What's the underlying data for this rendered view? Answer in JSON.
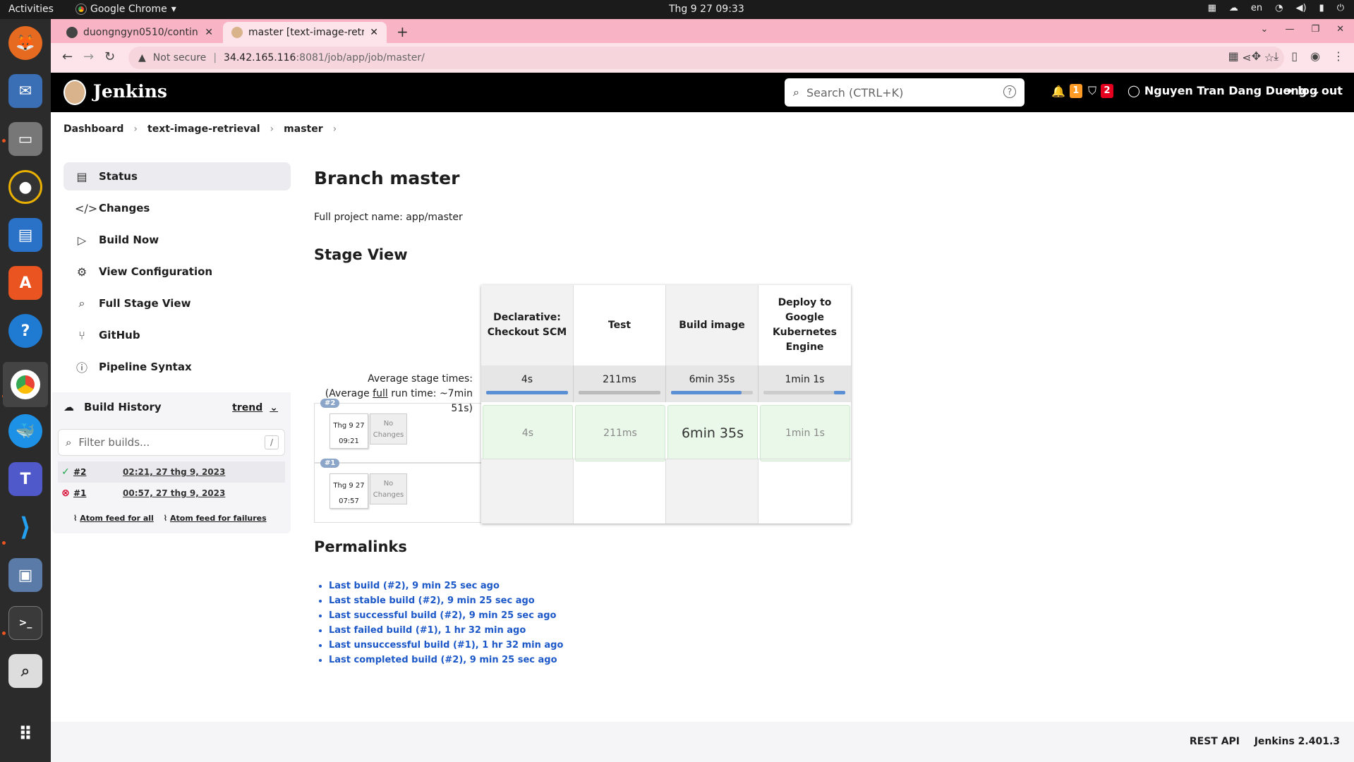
{
  "os": {
    "activities": "Activities",
    "app_name": "Google Chrome",
    "clock": "Thg 9 27  09:33",
    "lang": "en"
  },
  "browser": {
    "tabs": [
      {
        "title": "duongngyn0510/continu"
      },
      {
        "title": "master [text-image-retrie"
      }
    ],
    "not_secure": "Not secure",
    "url_host": "34.42.165.116",
    "url_path": ":8081/job/app/job/master/"
  },
  "jenkins": {
    "title": "Jenkins",
    "search_placeholder": "Search (CTRL+K)",
    "notifications_count": "1",
    "security_count": "2",
    "user": "Nguyen Tran Dang Duong",
    "logout": "log out"
  },
  "breadcrumb": [
    "Dashboard",
    "text-image-retrieval",
    "master"
  ],
  "side": {
    "items": [
      {
        "label": "Status",
        "icon": "status-icon"
      },
      {
        "label": "Changes",
        "icon": "code-icon"
      },
      {
        "label": "Build Now",
        "icon": "play-icon"
      },
      {
        "label": "View Configuration",
        "icon": "gear-icon"
      },
      {
        "label": "Full Stage View",
        "icon": "search-icon"
      },
      {
        "label": "GitHub",
        "icon": "branch-icon"
      },
      {
        "label": "Pipeline Syntax",
        "icon": "help-icon"
      }
    ]
  },
  "build_history": {
    "title": "Build History",
    "trend": "trend",
    "filter_placeholder": "Filter builds...",
    "filter_shortcut": "/",
    "builds": [
      {
        "num": "#2",
        "date": "02:21, 27 thg 9, 2023",
        "status": "success"
      },
      {
        "num": "#1",
        "date": "00:57, 27 thg 9, 2023",
        "status": "failed"
      }
    ],
    "feed_all": "Atom feed for all",
    "feed_failures": "Atom feed for failures"
  },
  "main": {
    "title": "Branch master",
    "full_name": "Full project name: app/master",
    "stage_view_title": "Stage View",
    "avg_label_1": "Average stage times:",
    "avg_label_2a": "(Average ",
    "avg_label_2b": "full",
    "avg_label_2c": " run time: ~7min",
    "avg_label_3": "51s)",
    "stages": [
      {
        "name": "Declarative: Checkout SCM",
        "avg": "4s",
        "avg_fill": 1.0
      },
      {
        "name": "Test",
        "avg": "211ms",
        "avg_fill": 1.0
      },
      {
        "name": "Build image",
        "avg": "6min 35s",
        "avg_fill": 0.86
      },
      {
        "name": "Deploy to Google Kubernetes Engine",
        "avg": "1min 1s",
        "avg_fill": 0.14
      }
    ],
    "runs": [
      {
        "badge": "#2",
        "date": "Thg 9 27",
        "time": "09:21",
        "changes": "No Changes",
        "cells": [
          "4s",
          "211ms",
          "6min 35s",
          "1min 1s"
        ]
      },
      {
        "badge": "#1",
        "date": "Thg 9 27",
        "time": "07:57",
        "changes": "No Changes",
        "cells": []
      }
    ],
    "permalinks_title": "Permalinks",
    "permalinks": [
      "Last build (#2), 9 min 25 sec ago",
      "Last stable build (#2), 9 min 25 sec ago",
      "Last successful build (#2), 9 min 25 sec ago",
      "Last failed build (#1), 1 hr 32 min ago",
      "Last unsuccessful build (#1), 1 hr 32 min ago",
      "Last completed build (#2), 9 min 25 sec ago"
    ]
  },
  "footer": {
    "rest_api": "REST API",
    "version": "Jenkins 2.401.3"
  }
}
